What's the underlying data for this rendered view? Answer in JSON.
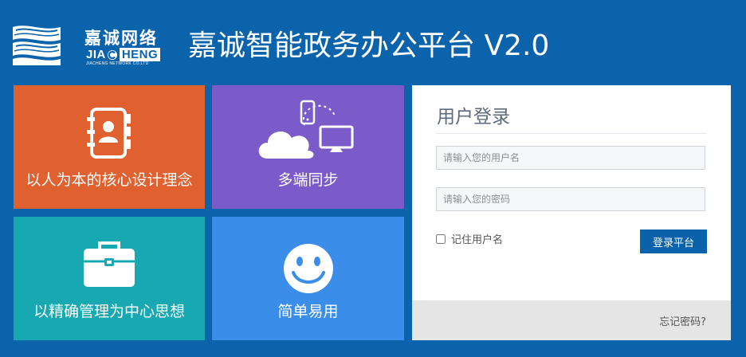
{
  "header": {
    "logo_cn": "嘉诚网络",
    "logo_en_part1": "JIA",
    "logo_en_part2": "HENG",
    "logo_en_sub": "JIACHENG NETWORK CO.LTD",
    "title": "嘉诚智能政务办公平台 V2.0"
  },
  "tiles": [
    {
      "label": "以人为本的核心设计理念",
      "icon": "address-book-icon",
      "color": "#e0602f"
    },
    {
      "label": "多端同步",
      "icon": "cloud-sync-devices-icon",
      "color": "#7a5bc9"
    },
    {
      "label": "以精确管理为中心思想",
      "icon": "briefcase-icon",
      "color": "#17a8b2"
    },
    {
      "label": "简单易用",
      "icon": "smiley-icon",
      "color": "#3a8de8"
    }
  ],
  "login": {
    "title": "用户登录",
    "username_placeholder": "请输入您的用户名",
    "username_value": "",
    "password_placeholder": "请输入您的密码",
    "password_value": "",
    "remember_label": "记住用户名",
    "submit_label": "登录平台",
    "forgot_label": "忘记密码?"
  },
  "colors": {
    "background": "#0b63ab",
    "button": "#0a62ab"
  }
}
